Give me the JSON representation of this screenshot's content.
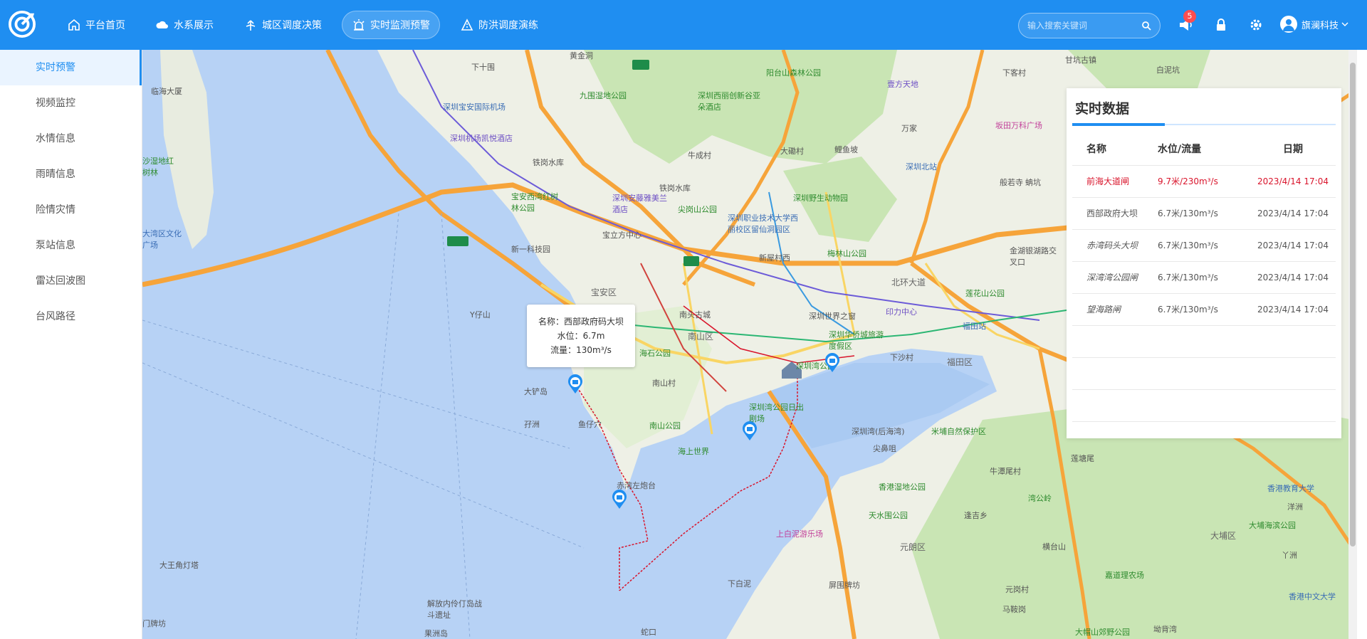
{
  "header": {
    "nav": [
      {
        "label": "平台首页",
        "icon": "home-icon"
      },
      {
        "label": "水系展示",
        "icon": "cloud-icon"
      },
      {
        "label": "城区调度决策",
        "icon": "directions-icon"
      },
      {
        "label": "实时监测预警",
        "icon": "alarm-icon",
        "active": true
      },
      {
        "label": "防洪调度演练",
        "icon": "rehearsal-icon"
      }
    ],
    "search_placeholder": "输入搜索关键词",
    "notification_count": "5",
    "user_name": "旗澜科技"
  },
  "sidebar": {
    "items": [
      {
        "label": "实时预警",
        "active": true
      },
      {
        "label": "视频监控"
      },
      {
        "label": "水情信息"
      },
      {
        "label": "雨晴信息"
      },
      {
        "label": "险情灾情"
      },
      {
        "label": "泵站信息"
      },
      {
        "label": "雷达回波图"
      },
      {
        "label": "台风路径"
      }
    ]
  },
  "tooltip": {
    "name": "名称：西部政府码大坝",
    "level": "水位：6.7m",
    "flow": "流量：130m³/s"
  },
  "panel": {
    "title": "实时数据",
    "columns": [
      "名称",
      "水位/流量",
      "日期"
    ],
    "rows": [
      {
        "name": "前海大道闸",
        "value": "9.7米/230m³/s",
        "date": "2023/4/14 17:04",
        "alert": true
      },
      {
        "name": "西部政府大坝",
        "value": "6.7米/130m³/s",
        "date": "2023/4/14 17:04"
      },
      {
        "name": "赤湾码头大坝",
        "value": "6.7米/130m³/s",
        "date": "2023/4/14 17:04"
      },
      {
        "name": "深湾湾公园闸",
        "value": "6.7米/130m³/s",
        "date": "2023/4/14 17:04"
      },
      {
        "name": "望海路闸",
        "value": "6.7米/130m³/s",
        "date": "2023/4/14 17:04"
      }
    ]
  },
  "map": {
    "labels": {
      "l1": "下十围",
      "l2": "黄金洞",
      "l3": "阳台山森林公园",
      "l4": "壹方天地",
      "l5": "下客村",
      "l6": "甘坑古镇",
      "l7": "白泥坑",
      "l8": "临海大厦",
      "l9": "九围湿地公园",
      "l10": "深圳西丽创新谷亚朵酒店",
      "l11": "深圳宝安国际机场",
      "l12": "深圳机场凯悦酒店",
      "l13": "万家",
      "l14": "坂田万科广场",
      "l15": "沙湿地红树林",
      "l16": "铁岗水库",
      "l17": "牛成村",
      "l18": "大磡村",
      "l19": "鲤鱼坡",
      "l20": "深圳北站",
      "l21": "般若寺",
      "l22": "G2518",
      "l23": "宝安西湾红树林公园",
      "l24": "深圳安藤雅美兰酒店",
      "l25": "铁岗水库",
      "l26": "尖岗山公园",
      "l27": "深圳野生动物园",
      "l28": "大湾区文化广场",
      "l29": "宝立方中心",
      "l30": "深圳职业技术大学西丽校区留仙洞园区",
      "l31": "金湖银湖路交叉口",
      "l32": "新一科技园",
      "l33": "梅林山公园",
      "l34": "新屋村西",
      "l35": "G4",
      "l36": "北环大道",
      "l37": "莲花山公园",
      "l38": "宝安区",
      "l39": "Y仔山",
      "l40": "南头古城",
      "l41": "深圳世界之窗",
      "l42": "印力中心",
      "l43": "福田站",
      "l44": "南山区",
      "l45": "深圳华侨城旅游度假区",
      "l46": "海石公园",
      "l47": "下沙村",
      "l48": "福田区",
      "l49": "南山村",
      "l50": "深圳湾公园",
      "l51": "大铲岛",
      "l52": "深圳湾公园日出剧场",
      "l53": "深圳湾(后海湾)",
      "l54": "米埔自然保护区",
      "l55": "鱼仔穴",
      "l56": "孖洲",
      "l57": "南山公园",
      "l58": "海上世界",
      "l59": "莲塘尾",
      "l60": "牛潭尾村",
      "l61": "香港湿地公园",
      "l62": "尖鼻咀",
      "l63": "赤湾左炮台",
      "l64": "湾公岭",
      "l65": "香港教育大学",
      "l66": "天水围公园",
      "l67": "逢吉乡",
      "l68": "大埔海滨公园",
      "l69": "上白泥游乐场",
      "l70": "元朗区",
      "l71": "横台山",
      "l72": "大埔区",
      "l73": "大王角灯塔",
      "l74": "屏山",
      "l75": "嘉道理农场",
      "l76": "香港中文大学",
      "l77": "下白泥",
      "l78": "屏围牌坊",
      "l79": "元岗村",
      "l80": "解放内伶仃岛战斗遗址",
      "l81": "马鞍岗",
      "l82": "大帽山郊野公园",
      "l83": "门牌坊",
      "l84": "果洲岛",
      "l85": "坳背湾",
      "l86": "蛇口",
      "l87": "洋洲",
      "l88": "丫洲",
      "l89": "蚺坑",
      "l90": "S33"
    }
  },
  "colors": {
    "accent": "#1f8ef1",
    "alert": "#d9142b",
    "water": "#b7d2f5"
  }
}
